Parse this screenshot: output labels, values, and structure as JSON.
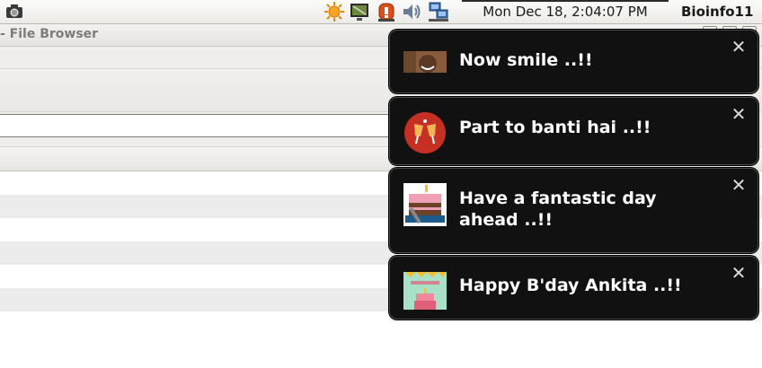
{
  "panel": {
    "clock": "Mon Dec 18,  2:04:07 PM",
    "user": "Bioinfo11",
    "icons": [
      "camera-icon",
      "weather-sun-icon",
      "display-icon",
      "alert-siren-icon",
      "volume-icon",
      "network-icon"
    ]
  },
  "window": {
    "title": "- File Browser"
  },
  "notifications": [
    {
      "message": "Now smile ..!!",
      "thumb": "portrait-thumbnail"
    },
    {
      "message": "Part to banti hai ..!!",
      "thumb": "cheers-glasses-thumbnail"
    },
    {
      "message": "Have a fantastic day ahead ..!!",
      "thumb": "birthday-cake-thumbnail"
    },
    {
      "message": "Happy B'day Ankita ..!!",
      "thumb": "happy-birthday-card-thumbnail"
    }
  ],
  "colors": {
    "notification_bg": "#111111",
    "notification_text": "#ffffff",
    "panel_bg": "#f3f2ef",
    "row_alt": "#ececec"
  }
}
